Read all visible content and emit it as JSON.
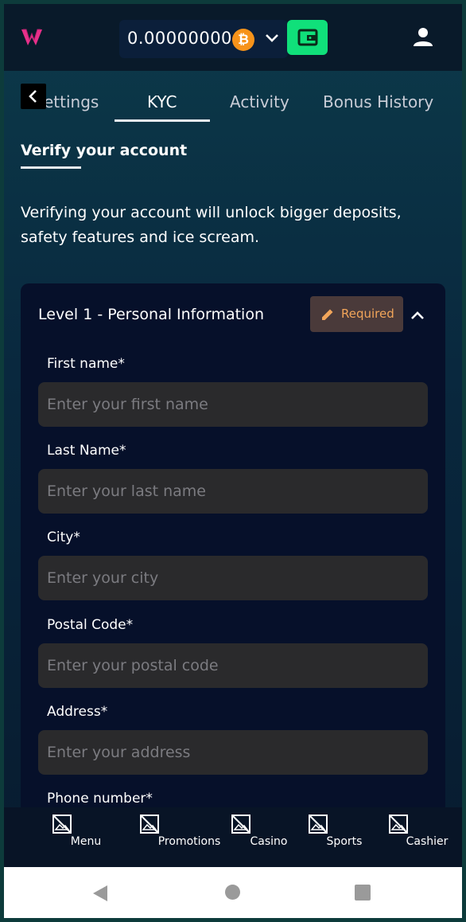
{
  "header": {
    "balance": "0.00000000",
    "currency_symbol": "₿",
    "currency_icon": "bitcoin-icon",
    "accent_color": "#10e07a"
  },
  "tabs": [
    {
      "label": "ettings"
    },
    {
      "label": "KYC",
      "active": true
    },
    {
      "label": "Activity"
    },
    {
      "label": "Bonus History"
    }
  ],
  "section": {
    "title": "Verify your account",
    "description": "Verifying your account will unlock bigger deposits, safety features and ice scream."
  },
  "card": {
    "title": "Level 1 - Personal Information",
    "badge": "Required",
    "fields": [
      {
        "label": "First name*",
        "placeholder": "Enter your first name"
      },
      {
        "label": "Last Name*",
        "placeholder": "Enter your last name"
      },
      {
        "label": "City*",
        "placeholder": "Enter your city"
      },
      {
        "label": "Postal Code*",
        "placeholder": "Enter your postal code"
      },
      {
        "label": "Address*",
        "placeholder": "Enter your address"
      },
      {
        "label": "Phone number*"
      }
    ]
  },
  "bottom_nav": [
    {
      "label": "Menu",
      "icon": "broken-image-icon"
    },
    {
      "label": "Promotions",
      "icon": "broken-image-icon"
    },
    {
      "label": "Casino",
      "icon": "broken-image-icon"
    },
    {
      "label": "Sports",
      "icon": "broken-image-icon"
    },
    {
      "label": "Cashier",
      "icon": "broken-image-icon"
    }
  ]
}
